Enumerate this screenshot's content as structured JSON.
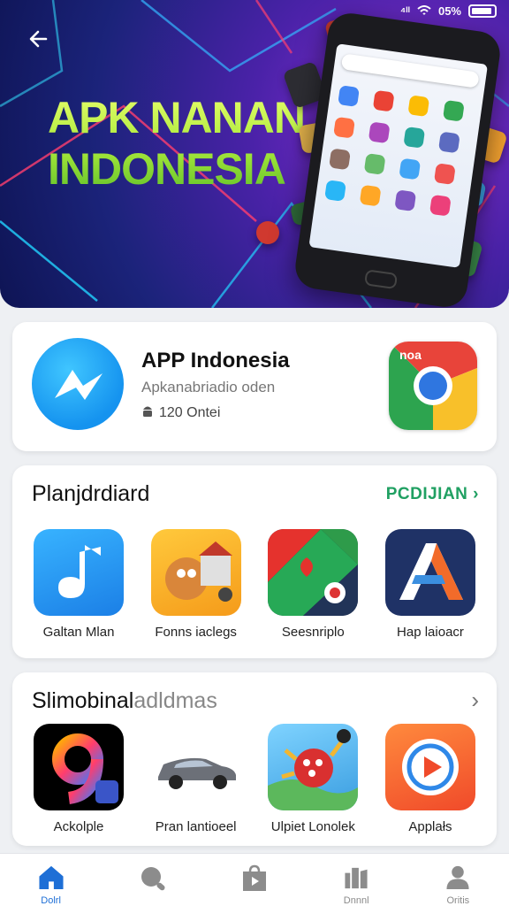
{
  "status_bar": {
    "signal": "⁴ᴵᴵ",
    "battery_text": "05%"
  },
  "hero": {
    "title_line1": "APK NANAN",
    "title_line2": "INDONESIA"
  },
  "featured": {
    "title": "APP Indonesia",
    "subtitle": "Apkanabriadio oden",
    "meta": "120 Ontei",
    "right_badge": "noa"
  },
  "section1": {
    "title": "Planjdrdiard",
    "link": "PCDIJIAN",
    "apps": [
      {
        "label": "Galtan Mlan",
        "icon": "music-note-icon"
      },
      {
        "label": "Fonns iaclegs",
        "icon": "game-character-icon"
      },
      {
        "label": "Seesnriplo",
        "icon": "map-pin-icon"
      },
      {
        "label": "Hap laioacr",
        "icon": "letter-a-icon"
      }
    ]
  },
  "section2": {
    "title": "Slimobinal",
    "title_muted": "adldmas",
    "apps": [
      {
        "label": "Ackolple",
        "icon": "number-nine-icon"
      },
      {
        "label": "Pran lantioeel",
        "icon": "car-icon"
      },
      {
        "label": "Ulpiet Lonolek",
        "icon": "cartoon-game-icon"
      },
      {
        "label": "Applałs",
        "icon": "play-button-icon"
      }
    ]
  },
  "nav": [
    {
      "label": "Dolrl",
      "icon": "home-icon",
      "active": true
    },
    {
      "label": "",
      "icon": "search-icon"
    },
    {
      "label": "",
      "icon": "store-bag-icon"
    },
    {
      "label": "Dnnnl",
      "icon": "library-icon"
    },
    {
      "label": "Oritis",
      "icon": "profile-icon"
    }
  ],
  "colors": {
    "accent_green": "#20a062",
    "nav_active": "#1e6fd6",
    "hero_bg": "#1b237a"
  }
}
